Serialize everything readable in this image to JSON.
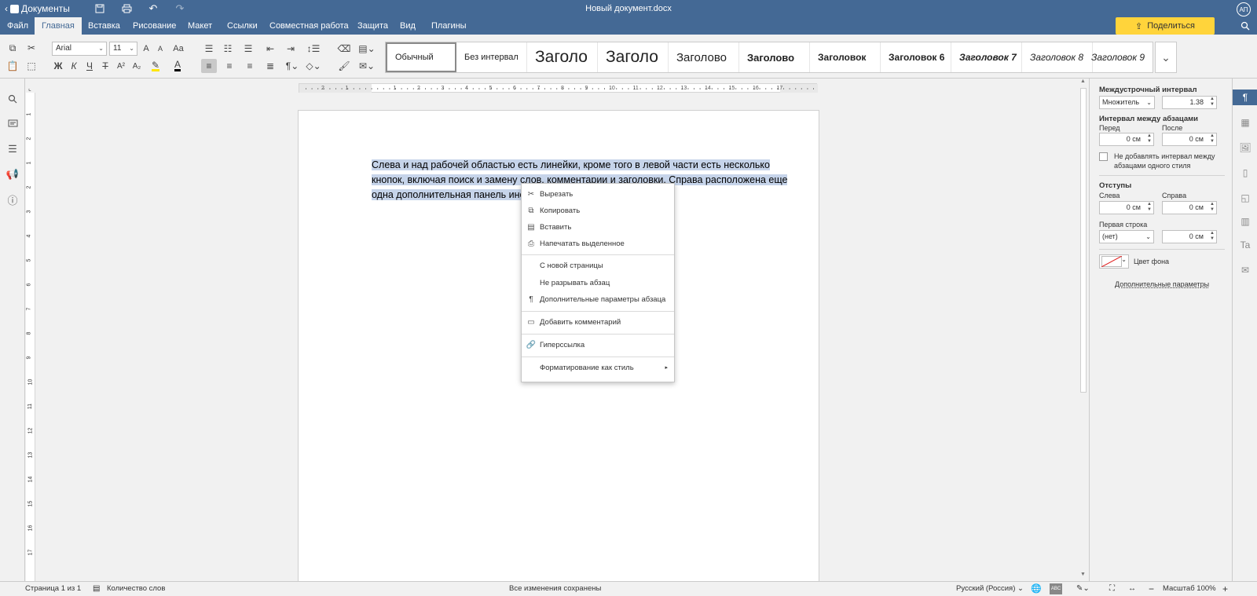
{
  "titlebar": {
    "app_name": "Документы",
    "doc_title": "Новый документ.docx",
    "share_label": "Поделиться",
    "avatar_initials": "АП",
    "accent": "#446995"
  },
  "menu": {
    "tabs": [
      "Файл",
      "Главная",
      "Вставка",
      "Рисование",
      "Макет",
      "Ссылки",
      "Совместная работа",
      "Защита",
      "Вид",
      "Плагины"
    ],
    "active": "Главная"
  },
  "toolbar": {
    "font_name": "Arial",
    "font_size": "11",
    "bold": "Ж",
    "italic": "К",
    "underline": "Ч",
    "strike": "Т",
    "superscript": "A²",
    "subscript": "A₂",
    "font_color": "A",
    "grow": "A",
    "shrink": "A",
    "case": "Aa"
  },
  "styles": [
    "Обычный",
    "Без интервал",
    "Заголо",
    "Заголо",
    "Заголово",
    "Заголово",
    "Заголовок",
    "Заголовок 6",
    "Заголовок 7",
    "Заголовок 8",
    "Заголовок 9"
  ],
  "document": {
    "text_lines": [
      "Слева и над рабочей областью есть линейки, кроме того в левой части есть несколько",
      "кнопок, включая поиск и замену слов, комментарии и заголовки. Справа расположена еще",
      "одна дополнительная панель инструментов."
    ]
  },
  "ruler": {
    "h_labels": [
      "2",
      "1",
      "1",
      "2",
      "3",
      "4",
      "5",
      "6",
      "7",
      "8",
      "9",
      "10",
      "11",
      "12",
      "13",
      "14",
      "15",
      "16",
      "17"
    ],
    "v_labels": [
      "1",
      "2",
      "1",
      "2",
      "3",
      "4",
      "5",
      "6",
      "7",
      "8",
      "9",
      "10",
      "11",
      "12",
      "13",
      "14",
      "15",
      "16",
      "17"
    ]
  },
  "context_menu": {
    "items": [
      {
        "label": "Вырезать",
        "icon": "scissors-icon"
      },
      {
        "label": "Копировать",
        "icon": "copy-icon"
      },
      {
        "label": "Вставить",
        "icon": "paste-icon"
      },
      {
        "label": "Напечатать выделенное",
        "icon": "printer-icon"
      },
      {
        "label": "С новой страницы",
        "icon": ""
      },
      {
        "label": "Не разрывать абзац",
        "icon": ""
      },
      {
        "label": "Дополнительные параметры абзаца",
        "icon": "pilcrow-icon"
      },
      {
        "label": "Добавить комментарий",
        "icon": "comment-icon"
      },
      {
        "label": "Гиперссылка",
        "icon": "link-icon"
      },
      {
        "label": "Форматирование как стиль",
        "icon": ""
      }
    ]
  },
  "right_panel": {
    "line_spacing_title": "Междустрочный интервал",
    "line_spacing_mode": "Множитель",
    "line_spacing_value": "1.38",
    "paragraph_spacing_title": "Интервал между абзацами",
    "before_label": "Перед",
    "before_value": "0 см",
    "after_label": "После",
    "after_value": "0 см",
    "no_spacing_checkbox": "Не добавлять интервал между абзацами одного стиля",
    "indents_title": "Отступы",
    "left_label": "Слева",
    "left_value": "0 см",
    "right_label": "Справа",
    "right_value": "0 см",
    "first_line_label": "Первая строка",
    "first_line_mode": "(нет)",
    "first_line_value": "0 см",
    "bg_color_label": "Цвет фона",
    "advanced_link": "Дополнительные параметры"
  },
  "statusbar": {
    "page_info": "Страница 1 из 1",
    "word_count": "Количество слов",
    "save_status": "Все изменения сохранены",
    "language": "Русский (Россия)",
    "zoom": "Масштаб 100%"
  }
}
